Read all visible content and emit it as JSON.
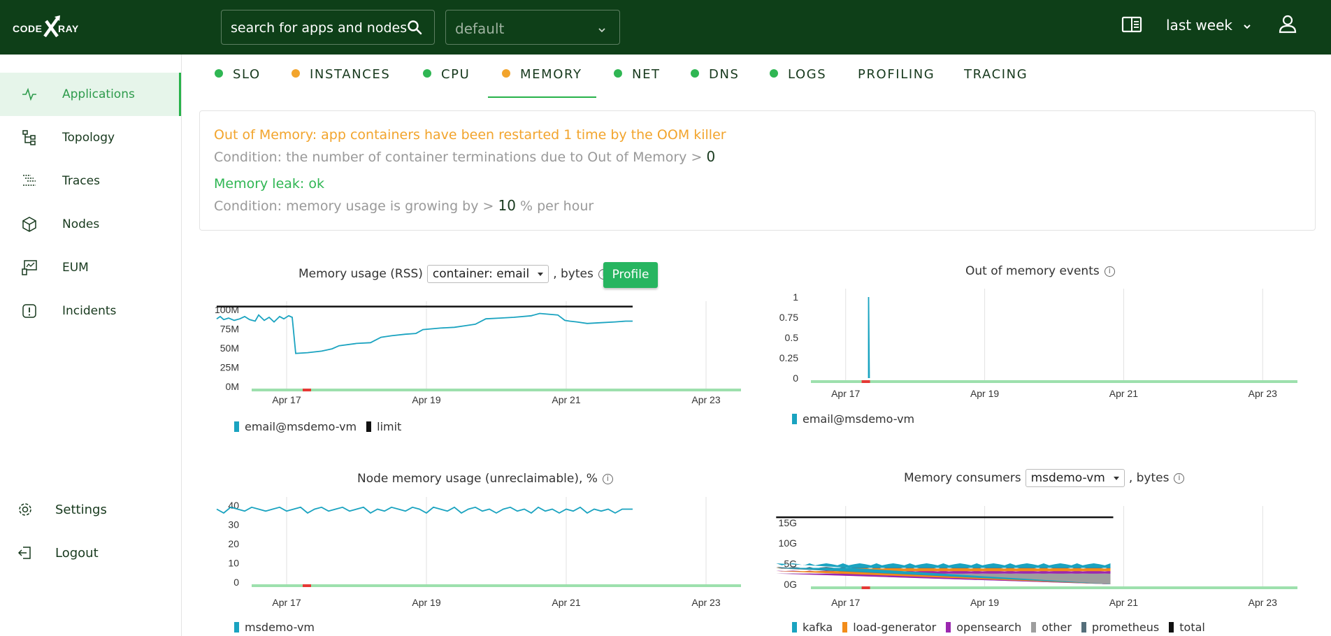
{
  "header": {
    "logo_text": "CODEXRAY",
    "search_placeholder": "search for apps and nodes",
    "project": "default",
    "time_range": "last week"
  },
  "sidebar": {
    "items": [
      {
        "label": "Applications",
        "icon": "pulse-icon",
        "active": true
      },
      {
        "label": "Topology",
        "icon": "topology-icon"
      },
      {
        "label": "Traces",
        "icon": "traces-icon"
      },
      {
        "label": "Nodes",
        "icon": "cube-icon"
      },
      {
        "label": "EUM",
        "icon": "eum-icon"
      },
      {
        "label": "Incidents",
        "icon": "alert-icon"
      }
    ],
    "bottom": [
      {
        "label": "Settings",
        "icon": "gear-icon"
      },
      {
        "label": "Logout",
        "icon": "logout-icon"
      }
    ]
  },
  "tabs": [
    {
      "label": "SLO",
      "status": "ok"
    },
    {
      "label": "INSTANCES",
      "status": "warning"
    },
    {
      "label": "CPU",
      "status": "ok"
    },
    {
      "label": "MEMORY",
      "status": "warning",
      "active": true
    },
    {
      "label": "NET",
      "status": "ok"
    },
    {
      "label": "DNS",
      "status": "ok"
    },
    {
      "label": "LOGS",
      "status": "ok"
    },
    {
      "label": "PROFILING",
      "status": "none"
    },
    {
      "label": "TRACING",
      "status": "none"
    }
  ],
  "colors": {
    "header_bg": "#0e3f18",
    "ok": "#2fb653",
    "warning": "#f2a42c",
    "accent": "#27b24a",
    "series_teal": "#1aa3c0"
  },
  "checks": [
    {
      "title": "Out of Memory: app containers have been restarted 1 time by the OOM killer",
      "status": "warning",
      "condition_prefix": "Condition: the number of container terminations due to Out of Memory >",
      "threshold": "0",
      "condition_suffix": ""
    },
    {
      "title": "Memory leak: ok",
      "status": "ok",
      "condition_prefix": "Condition: memory usage is growing by >",
      "threshold": "10",
      "condition_suffix": "% per hour"
    }
  ],
  "charts_ui": {
    "rss_title": "Memory usage (RSS)",
    "rss_select": "container: email",
    "rss_suffix": ", bytes",
    "profile_button": "Profile",
    "oom_title": "Out of memory events",
    "node_title": "Node memory usage (unreclaimable), %",
    "consumers_title": "Memory consumers",
    "consumers_select": "msdemo-vm",
    "consumers_suffix": ", bytes"
  },
  "chart_data": [
    {
      "type": "line",
      "title": "Memory usage (RSS)",
      "x_ticks": [
        "Apr 17",
        "Apr 19",
        "Apr 21",
        "Apr 23"
      ],
      "y_ticks": [
        "0M",
        "25M",
        "50M",
        "75M",
        "100M"
      ],
      "ylim": [
        0,
        100
      ],
      "y_unit": "M",
      "x_days": [
        16.5,
        23.5
      ],
      "legend": [
        "email@msdemo-vm",
        "limit"
      ],
      "series": [
        {
          "name": "email@msdemo-vm",
          "color": "#1aa3c0",
          "points": [
            [
              16.0,
              88
            ],
            [
              16.05,
              91
            ],
            [
              16.1,
              87
            ],
            [
              16.17,
              89
            ],
            [
              16.25,
              86
            ],
            [
              16.33,
              88
            ],
            [
              16.4,
              91
            ],
            [
              16.47,
              87
            ],
            [
              16.55,
              85
            ],
            [
              16.6,
              93
            ],
            [
              16.68,
              86
            ],
            [
              16.75,
              90
            ],
            [
              16.82,
              84
            ],
            [
              16.9,
              91
            ],
            [
              16.96,
              88
            ],
            [
              17.03,
              92
            ],
            [
              17.08,
              90
            ],
            [
              17.13,
              43
            ],
            [
              17.3,
              44
            ],
            [
              17.5,
              46
            ],
            [
              17.65,
              49
            ],
            [
              17.75,
              53
            ],
            [
              18.0,
              56
            ],
            [
              18.2,
              57
            ],
            [
              18.35,
              64
            ],
            [
              18.5,
              66
            ],
            [
              18.7,
              68
            ],
            [
              18.85,
              69
            ],
            [
              18.95,
              74
            ],
            [
              19.2,
              76
            ],
            [
              19.4,
              77
            ],
            [
              19.55,
              79
            ],
            [
              19.7,
              81
            ],
            [
              19.85,
              88
            ],
            [
              20.05,
              89
            ],
            [
              20.25,
              90
            ],
            [
              20.5,
              92
            ],
            [
              20.62,
              95
            ],
            [
              20.75,
              94
            ],
            [
              20.88,
              93
            ],
            [
              20.98,
              86
            ],
            [
              21.05,
              85
            ],
            [
              21.15,
              84
            ],
            [
              21.3,
              82
            ],
            [
              21.5,
              83
            ],
            [
              21.7,
              84
            ],
            [
              21.85,
              85
            ],
            [
              21.95,
              85
            ]
          ]
        },
        {
          "name": "limit",
          "color": "#111111",
          "points": [
            [
              16.0,
              104
            ],
            [
              21.95,
              104
            ]
          ]
        }
      ],
      "event_markers": [
        17.23
      ]
    },
    {
      "type": "line",
      "title": "Out of memory events",
      "x_ticks": [
        "Apr 17",
        "Apr 19",
        "Apr 21",
        "Apr 23"
      ],
      "y_ticks": [
        "0",
        "0.25",
        "0.5",
        "0.75",
        "1"
      ],
      "ylim": [
        0,
        1
      ],
      "x_days": [
        16.5,
        23.5
      ],
      "legend": [
        "email@msdemo-vm"
      ],
      "series": [
        {
          "name": "email@msdemo-vm",
          "color": "#1aa3c0",
          "points": [
            [
              17.33,
              0
            ],
            [
              17.33,
              1
            ],
            [
              17.34,
              0
            ]
          ]
        }
      ],
      "event_markers": [
        17.23
      ]
    },
    {
      "type": "line",
      "title": "Node memory usage (unreclaimable), %",
      "x_ticks": [
        "Apr 17",
        "Apr 19",
        "Apr 21",
        "Apr 23"
      ],
      "y_ticks": [
        "0",
        "10",
        "20",
        "30",
        "40"
      ],
      "ylim": [
        0,
        40
      ],
      "x_days": [
        16.5,
        23.5
      ],
      "legend": [
        "msdemo-vm"
      ],
      "series": [
        {
          "name": "msdemo-vm",
          "color": "#1aa3c0",
          "points": [
            [
              16.0,
              38
            ],
            [
              16.1,
              36
            ],
            [
              16.2,
              39
            ],
            [
              16.3,
              38
            ],
            [
              16.4,
              37
            ],
            [
              16.5,
              39
            ],
            [
              16.6,
              38
            ],
            [
              16.7,
              37
            ],
            [
              16.8,
              38
            ],
            [
              16.9,
              39
            ],
            [
              17.0,
              37
            ],
            [
              17.1,
              38
            ],
            [
              17.2,
              39
            ],
            [
              17.3,
              36
            ],
            [
              17.4,
              38
            ],
            [
              17.5,
              39
            ],
            [
              17.6,
              37
            ],
            [
              17.7,
              38
            ],
            [
              17.8,
              39
            ],
            [
              17.9,
              37
            ],
            [
              18.0,
              38
            ],
            [
              18.1,
              39
            ],
            [
              18.2,
              36
            ],
            [
              18.3,
              38
            ],
            [
              18.4,
              37
            ],
            [
              18.5,
              39
            ],
            [
              18.6,
              38
            ],
            [
              18.7,
              37
            ],
            [
              18.8,
              39
            ],
            [
              18.9,
              38
            ],
            [
              19.0,
              36
            ],
            [
              19.1,
              39
            ],
            [
              19.2,
              38
            ],
            [
              19.3,
              37
            ],
            [
              19.4,
              39
            ],
            [
              19.5,
              36
            ],
            [
              19.6,
              38
            ],
            [
              19.7,
              39
            ],
            [
              19.8,
              37
            ],
            [
              19.9,
              38
            ],
            [
              20.0,
              36
            ],
            [
              20.1,
              38
            ],
            [
              20.2,
              39
            ],
            [
              20.3,
              37
            ],
            [
              20.4,
              38
            ],
            [
              20.5,
              36
            ],
            [
              20.6,
              39
            ],
            [
              20.7,
              37
            ],
            [
              20.8,
              38
            ],
            [
              20.9,
              36
            ],
            [
              21.0,
              38
            ],
            [
              21.1,
              37
            ],
            [
              21.2,
              39
            ],
            [
              21.3,
              36
            ],
            [
              21.4,
              38
            ],
            [
              21.5,
              37
            ],
            [
              21.6,
              38
            ],
            [
              21.7,
              36
            ],
            [
              21.8,
              38
            ],
            [
              21.95,
              38
            ]
          ]
        }
      ],
      "event_markers": [
        17.23
      ]
    },
    {
      "type": "area",
      "title": "Memory consumers",
      "x_ticks": [
        "Apr 17",
        "Apr 19",
        "Apr 21",
        "Apr 23"
      ],
      "y_ticks": [
        "0G",
        "5G",
        "10G",
        "15G"
      ],
      "ylim": [
        0,
        17
      ],
      "y_unit": "G",
      "x_days": [
        16.5,
        23.5
      ],
      "x_range": [
        16.0,
        20.85
      ],
      "legend": [
        "kafka",
        "load-generator",
        "opensearch",
        "other",
        "prometheus",
        "total"
      ],
      "series": [
        {
          "name": "other",
          "color": "#9e9e9e",
          "value": 2.6
        },
        {
          "name": "opensearch",
          "color": "#9b27af",
          "value": 0.6
        },
        {
          "name": "load-generator",
          "color": "#f28c1a",
          "value": 0.7
        },
        {
          "name": "prometheus",
          "color": "#546e7a",
          "value": 0.1
        },
        {
          "name": "kafka",
          "color": "#1aa3c0",
          "value": 0.8
        },
        {
          "name": "total",
          "color": "#111111",
          "value": 16.3,
          "line": true
        }
      ],
      "event_markers": [
        17.23
      ]
    }
  ]
}
